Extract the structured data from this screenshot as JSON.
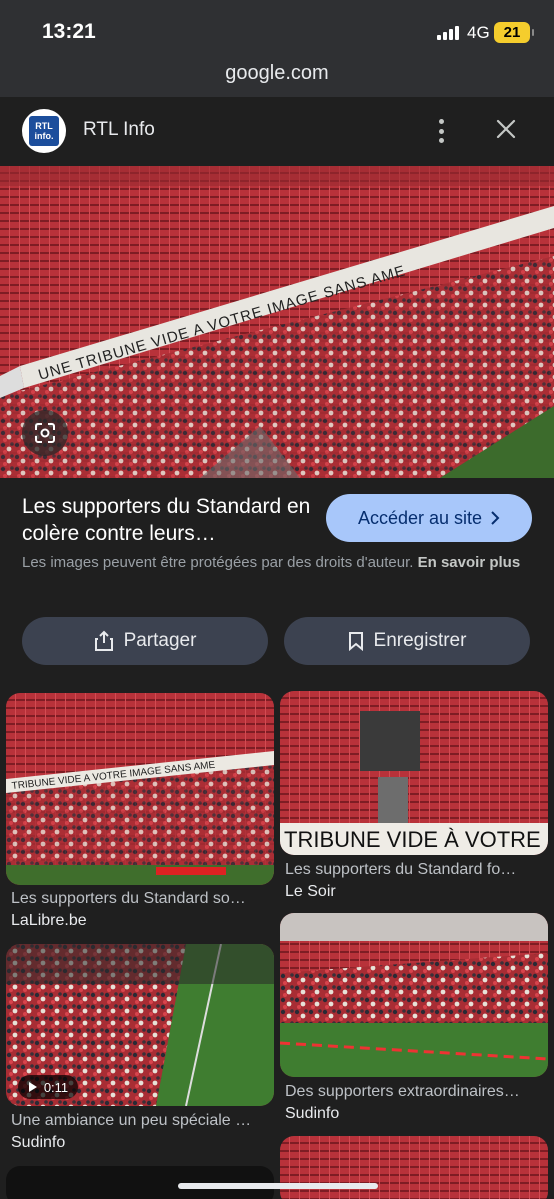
{
  "status_bar": {
    "time": "13:21",
    "network": "4G",
    "battery": "21"
  },
  "browser": {
    "url": "google.com"
  },
  "source": {
    "name": "RTL Info",
    "logo_text": "RTL info."
  },
  "hero": {
    "title": "Les supporters du Standard en colère contre leurs…",
    "cta_label": "Accéder au site",
    "copyright_text": "Les images peuvent être protégées par des droits d'auteur.",
    "learn_more": "En savoir plus"
  },
  "actions": {
    "share_label": "Partager",
    "save_label": "Enregistrer"
  },
  "results": [
    {
      "caption": "Les supporters du Standard so…",
      "site": "LaLibre.be"
    },
    {
      "caption": "Les supporters du Standard fo…",
      "site": "Le Soir"
    },
    {
      "caption": "Une ambiance un peu spéciale …",
      "site": "Sudinfo",
      "duration": "0:11"
    },
    {
      "caption": "Des supporters extraordinaires…",
      "site": "Sudinfo"
    }
  ],
  "icons": [
    "signal-icon",
    "kebab-menu-icon",
    "close-icon",
    "lens-icon",
    "chevron-right-icon",
    "share-icon",
    "bookmark-icon",
    "play-icon"
  ]
}
